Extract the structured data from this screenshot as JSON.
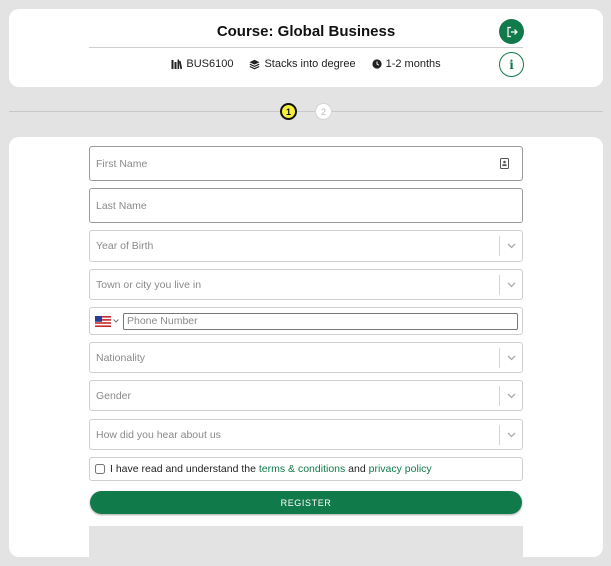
{
  "header": {
    "title": "Course: Global Business",
    "course_code": "BUS6100",
    "stacks": "Stacks into degree",
    "duration": "1-2 months"
  },
  "stepper": {
    "steps": [
      "1",
      "2"
    ],
    "active_step": 1
  },
  "form": {
    "first_name_placeholder": "First Name",
    "last_name_placeholder": "Last Name",
    "year_of_birth": "Year of Birth",
    "town_city": "Town or city you live in",
    "phone_placeholder": "Phone Number",
    "nationality": "Nationality",
    "gender": "Gender",
    "heard_about": "How did you hear about us",
    "consent_prefix": "I have read and understand the",
    "terms_link": "terms & conditions",
    "consent_and": "and",
    "privacy_link": "privacy policy",
    "register_label": "REGISTER"
  },
  "colors": {
    "brand_green": "#117a4a",
    "active_step": "#f4ee3c",
    "background": "#e3e3e3"
  }
}
